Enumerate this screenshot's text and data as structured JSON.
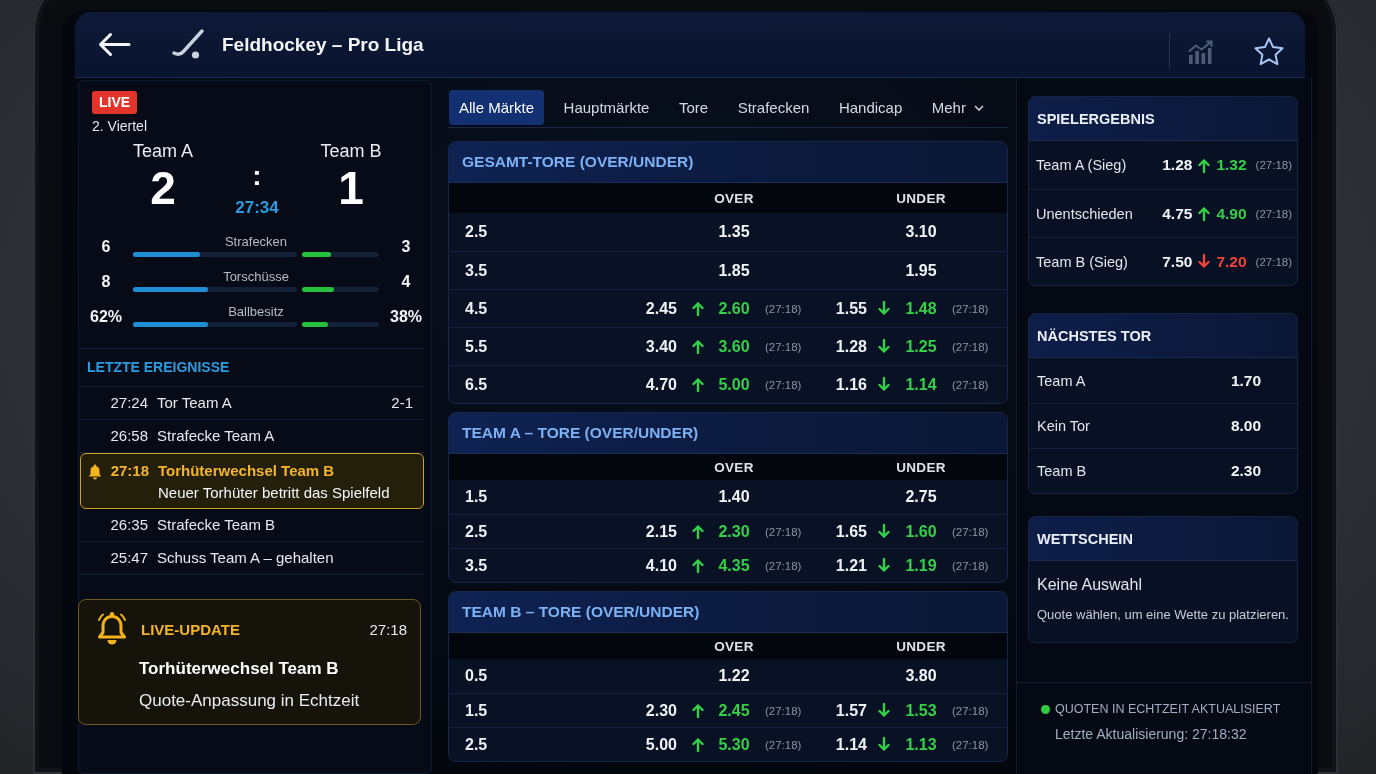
{
  "header": {
    "title": "Feldhockey – Pro Liga"
  },
  "match": {
    "badge": "LIVE",
    "period": "2. Viertel",
    "home": {
      "name": "Team A",
      "score": "2"
    },
    "away": {
      "name": "Team B",
      "score": "1"
    },
    "separator": ":",
    "clock": "27:34",
    "stats": [
      {
        "label": "Strafecken",
        "home": {
          "value": "6",
          "level": 0.41
        },
        "away": {
          "value": "3",
          "level": 0.38
        }
      },
      {
        "label": "Torschüsse",
        "home": {
          "value": "8",
          "level": 0.46
        },
        "away": {
          "value": "4",
          "level": 0.42
        }
      },
      {
        "label": "Ballbesitz",
        "home": {
          "value": "62%",
          "level": 0.46
        },
        "away": {
          "value": "38%",
          "level": 0.34
        }
      }
    ]
  },
  "events": {
    "title": "LETZTE EREIGNISSE",
    "items": [
      {
        "time": "27:24",
        "text": "Tor Team A",
        "score": "2-1",
        "highlighted": false
      },
      {
        "time": "26:58",
        "text": "Strafecke Team A",
        "highlighted": false
      },
      {
        "time": "27:18",
        "text": "Torhüterwechsel Team B",
        "detail": "Neuer Torhüter betritt das Spielfeld",
        "highlighted": true
      },
      {
        "time": "26:35",
        "text": "Strafecke Team B",
        "highlighted": false
      },
      {
        "time": "25:47",
        "text": "Schuss Team A – gehalten",
        "highlighted": false
      }
    ]
  },
  "live_update": {
    "title": "LIVE-UPDATE",
    "time": "27:18",
    "headline": "Torhüterwechsel Team B",
    "text": "Quote-Anpassung in Echtzeit"
  },
  "tabs": [
    {
      "label": "Alle Märkte",
      "kind": "tab",
      "selected": true
    },
    {
      "label": "Hauptmärkte",
      "kind": "tab",
      "selected": false
    },
    {
      "label": "Tore",
      "kind": "tab",
      "selected": false
    },
    {
      "label": "Strafecken",
      "kind": "tab",
      "selected": false
    },
    {
      "label": "Handicap",
      "kind": "tab",
      "selected": false
    },
    {
      "label": "Mehr",
      "kind": "dropdown",
      "selected": false
    }
  ],
  "markets": [
    {
      "title": "GESAMT-TORE (OVER/UNDER)",
      "columns": [
        "OVER",
        "UNDER"
      ],
      "rows": [
        {
          "line": "2.5",
          "over": {
            "value": "1.35"
          },
          "under": {
            "value": "3.10"
          }
        },
        {
          "line": "3.5",
          "over": {
            "value": "1.85"
          },
          "under": {
            "value": "1.95"
          }
        },
        {
          "line": "4.5",
          "over": {
            "previous": "2.45",
            "rising": true,
            "value": "2.60",
            "color": "#35d04a",
            "time": "(27:18)"
          },
          "under": {
            "previous": "1.55",
            "rising": false,
            "value": "1.48",
            "color": "#35d04a",
            "time": "(27:18)"
          }
        },
        {
          "line": "5.5",
          "over": {
            "previous": "3.40",
            "rising": true,
            "value": "3.60",
            "color": "#35d04a",
            "time": "(27:18)"
          },
          "under": {
            "previous": "1.28",
            "rising": false,
            "value": "1.25",
            "color": "#35d04a",
            "time": "(27:18)"
          }
        },
        {
          "line": "6.5",
          "over": {
            "previous": "4.70",
            "rising": true,
            "value": "5.00",
            "color": "#35d04a",
            "time": "(27:18)"
          },
          "under": {
            "previous": "1.16",
            "rising": false,
            "value": "1.14",
            "color": "#35d04a",
            "time": "(27:18)"
          }
        }
      ]
    },
    {
      "title": "TEAM A – TORE (OVER/UNDER)",
      "columns": [
        "OVER",
        "UNDER"
      ],
      "rows": [
        {
          "line": "1.5",
          "over": {
            "value": "1.40"
          },
          "under": {
            "value": "2.75"
          }
        },
        {
          "line": "2.5",
          "over": {
            "previous": "2.15",
            "rising": true,
            "value": "2.30",
            "color": "#35d04a",
            "time": "(27:18)"
          },
          "under": {
            "previous": "1.65",
            "rising": false,
            "value": "1.60",
            "color": "#35d04a",
            "time": "(27:18)"
          }
        },
        {
          "line": "3.5",
          "over": {
            "previous": "4.10",
            "rising": true,
            "value": "4.35",
            "color": "#35d04a",
            "time": "(27:18)"
          },
          "under": {
            "previous": "1.21",
            "rising": false,
            "value": "1.19",
            "color": "#35d04a",
            "time": "(27:18)"
          }
        }
      ]
    },
    {
      "title": "TEAM B – TORE (OVER/UNDER)",
      "columns": [
        "OVER",
        "UNDER"
      ],
      "rows": [
        {
          "line": "0.5",
          "over": {
            "value": "1.22"
          },
          "under": {
            "value": "3.80"
          }
        },
        {
          "line": "1.5",
          "over": {
            "previous": "2.30",
            "rising": true,
            "value": "2.45",
            "color": "#35d04a",
            "time": "(27:18)"
          },
          "under": {
            "previous": "1.57",
            "rising": false,
            "value": "1.53",
            "color": "#35d04a",
            "time": "(27:18)"
          }
        },
        {
          "line": "2.5",
          "over": {
            "previous": "5.00",
            "rising": true,
            "value": "5.30",
            "color": "#35d04a",
            "time": "(27:18)"
          },
          "under": {
            "previous": "1.14",
            "rising": false,
            "value": "1.13",
            "color": "#35d04a",
            "time": "(27:18)"
          }
        }
      ]
    }
  ],
  "match_result": {
    "title": "SPIELERGEBNIS",
    "rows": [
      {
        "label": "Team A (Sieg)",
        "previous": "1.28",
        "rising": true,
        "value": "1.32",
        "color": "#35d04a",
        "time": "(27:18)"
      },
      {
        "label": "Unentschieden",
        "previous": "4.75",
        "rising": true,
        "value": "4.90",
        "color": "#35d04a",
        "time": "(27:18)"
      },
      {
        "label": "Team B (Sieg)",
        "previous": "7.50",
        "rising": false,
        "value": "7.20",
        "color": "#f0443a",
        "time": "(27:18)"
      }
    ]
  },
  "next_goal": {
    "title": "NÄCHSTES TOR",
    "rows": [
      {
        "label": "Team A",
        "value": "1.70"
      },
      {
        "label": "Kein Tor",
        "value": "8.00"
      },
      {
        "label": "Team B",
        "value": "2.30"
      }
    ]
  },
  "bet_slip": {
    "title": "WETTSCHEIN",
    "empty_title": "Keine Auswahl",
    "hint": "Quote wählen, um eine Wette zu platzieren."
  },
  "status": {
    "online": true,
    "label": "QUOTEN IN ECHTZEIT AKTUALISIERT",
    "updated": "Letzte Aktualisierung: 27:18:32"
  }
}
